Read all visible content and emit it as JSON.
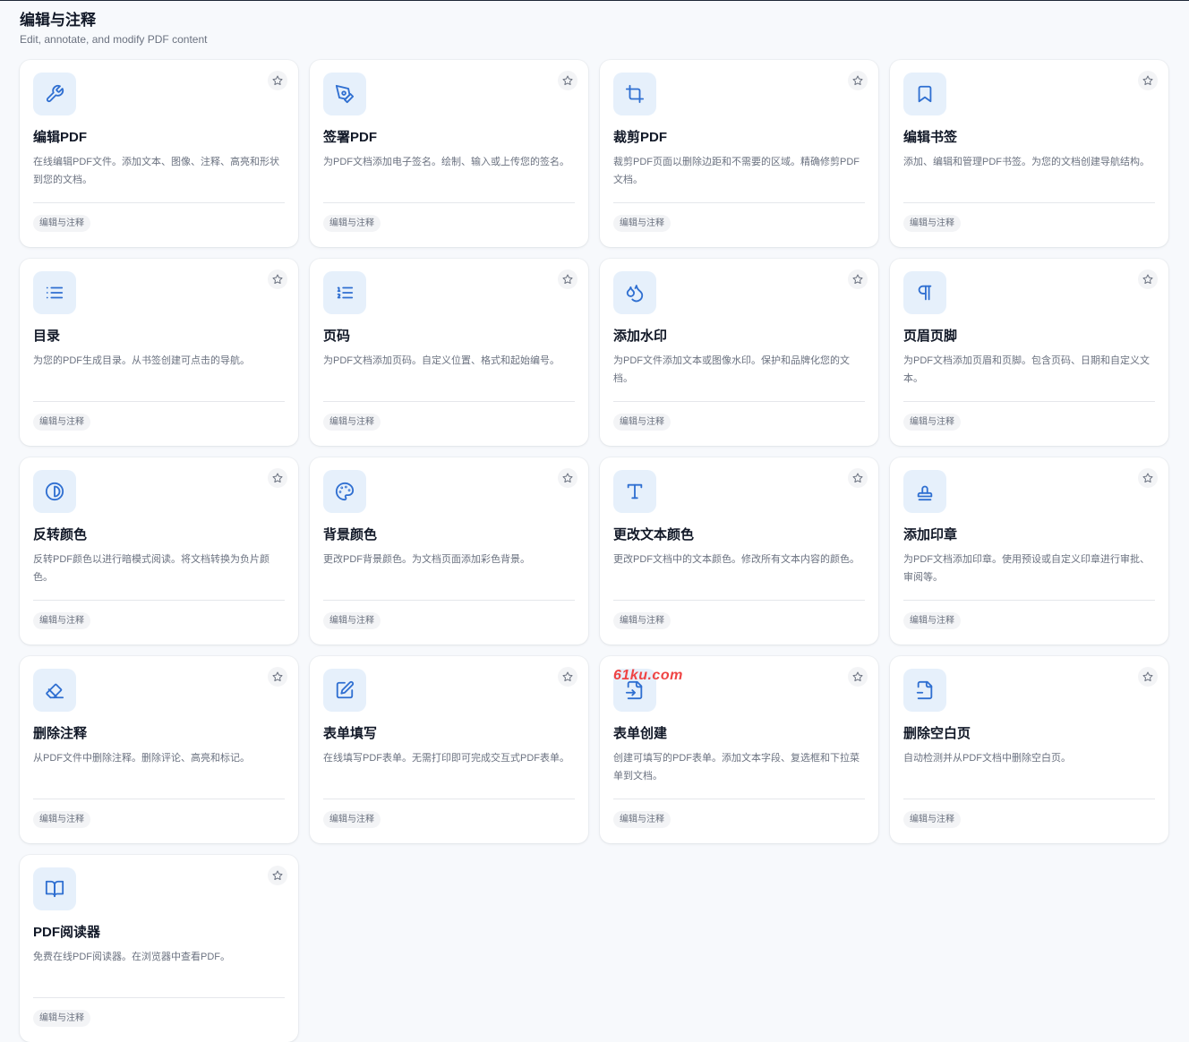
{
  "header": {
    "title": "编辑与注释",
    "subtitle": "Edit, annotate, and modify PDF content"
  },
  "watermark": "61ku.com",
  "cards": [
    {
      "icon": "wrench-icon",
      "title": "编辑PDF",
      "desc": "在线编辑PDF文件。添加文本、图像、注释、高亮和形状到您的文档。",
      "tag": "编辑与注释"
    },
    {
      "icon": "pen-tool-icon",
      "title": "签署PDF",
      "desc": "为PDF文档添加电子签名。绘制、输入或上传您的签名。",
      "tag": "编辑与注释"
    },
    {
      "icon": "crop-icon",
      "title": "裁剪PDF",
      "desc": "裁剪PDF页面以删除边距和不需要的区域。精确修剪PDF文档。",
      "tag": "编辑与注释"
    },
    {
      "icon": "bookmark-icon",
      "title": "编辑书签",
      "desc": "添加、编辑和管理PDF书签。为您的文档创建导航结构。",
      "tag": "编辑与注释"
    },
    {
      "icon": "list-icon",
      "title": "目录",
      "desc": "为您的PDF生成目录。从书签创建可点击的导航。",
      "tag": "编辑与注释"
    },
    {
      "icon": "list-ordered-icon",
      "title": "页码",
      "desc": "为PDF文档添加页码。自定义位置、格式和起始编号。",
      "tag": "编辑与注释"
    },
    {
      "icon": "droplets-icon",
      "title": "添加水印",
      "desc": "为PDF文件添加文本或图像水印。保护和品牌化您的文档。",
      "tag": "编辑与注释"
    },
    {
      "icon": "pilcrow-icon",
      "title": "页眉页脚",
      "desc": "为PDF文档添加页眉和页脚。包含页码、日期和自定义文本。",
      "tag": "编辑与注释"
    },
    {
      "icon": "contrast-icon",
      "title": "反转颜色",
      "desc": "反转PDF颜色以进行暗模式阅读。将文档转换为负片颜色。",
      "tag": "编辑与注释"
    },
    {
      "icon": "palette-icon",
      "title": "背景颜色",
      "desc": "更改PDF背景颜色。为文档页面添加彩色背景。",
      "tag": "编辑与注释"
    },
    {
      "icon": "type-icon",
      "title": "更改文本颜色",
      "desc": "更改PDF文档中的文本颜色。修改所有文本内容的颜色。",
      "tag": "编辑与注释"
    },
    {
      "icon": "stamp-icon",
      "title": "添加印章",
      "desc": "为PDF文档添加印章。使用预设或自定义印章进行审批、审阅等。",
      "tag": "编辑与注释"
    },
    {
      "icon": "eraser-icon",
      "title": "删除注释",
      "desc": "从PDF文件中删除注释。删除评论、高亮和标记。",
      "tag": "编辑与注释"
    },
    {
      "icon": "edit-icon",
      "title": "表单填写",
      "desc": "在线填写PDF表单。无需打印即可完成交互式PDF表单。",
      "tag": "编辑与注释"
    },
    {
      "icon": "file-input-icon",
      "title": "表单创建",
      "desc": "创建可填写的PDF表单。添加文本字段、复选框和下拉菜单到文档。",
      "tag": "编辑与注释"
    },
    {
      "icon": "file-minus-icon",
      "title": "删除空白页",
      "desc": "自动检测并从PDF文档中删除空白页。",
      "tag": "编辑与注释"
    },
    {
      "icon": "book-open-icon",
      "title": "PDF阅读器",
      "desc": "免费在线PDF阅读器。在浏览器中查看PDF。",
      "tag": "编辑与注释"
    }
  ]
}
